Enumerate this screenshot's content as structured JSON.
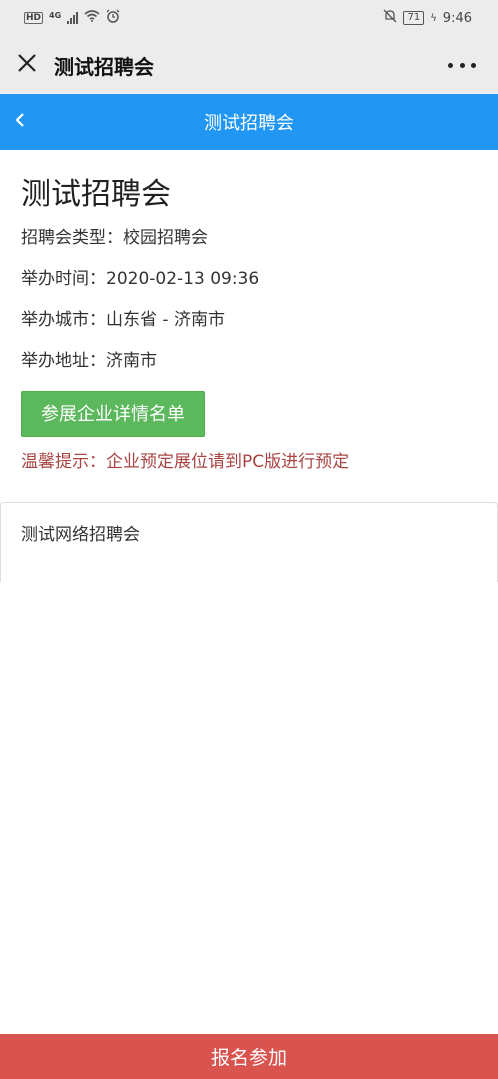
{
  "status_bar": {
    "hd": "HD",
    "net": "4G",
    "battery": "71",
    "time": "9:46"
  },
  "wx_header": {
    "title": "测试招聘会"
  },
  "nav": {
    "title": "测试招聘会"
  },
  "fair": {
    "title": "测试招聘会",
    "type_line": "招聘会类型：校园招聘会",
    "time_line": "举办时间：2020-02-13 09:36",
    "city_line": "举办城市：山东省 - 济南市",
    "address_line": "举办地址：济南市"
  },
  "buttons": {
    "companies_label": "参展企业详情名单",
    "signup_label": "报名参加"
  },
  "tip": "温馨提示：企业预定展位请到PC版进行预定",
  "card": {
    "text": "测试网络招聘会"
  },
  "colors": {
    "nav_blue": "#2196f3",
    "button_green": "#5cb85c",
    "tip_red": "#a94442",
    "signup_red": "#d9534f"
  },
  "icons": [
    "close-icon",
    "more-icon",
    "back-chevron-icon",
    "signal-icon",
    "wifi-icon",
    "alarm-icon",
    "mute-bell-icon",
    "battery-icon"
  ]
}
